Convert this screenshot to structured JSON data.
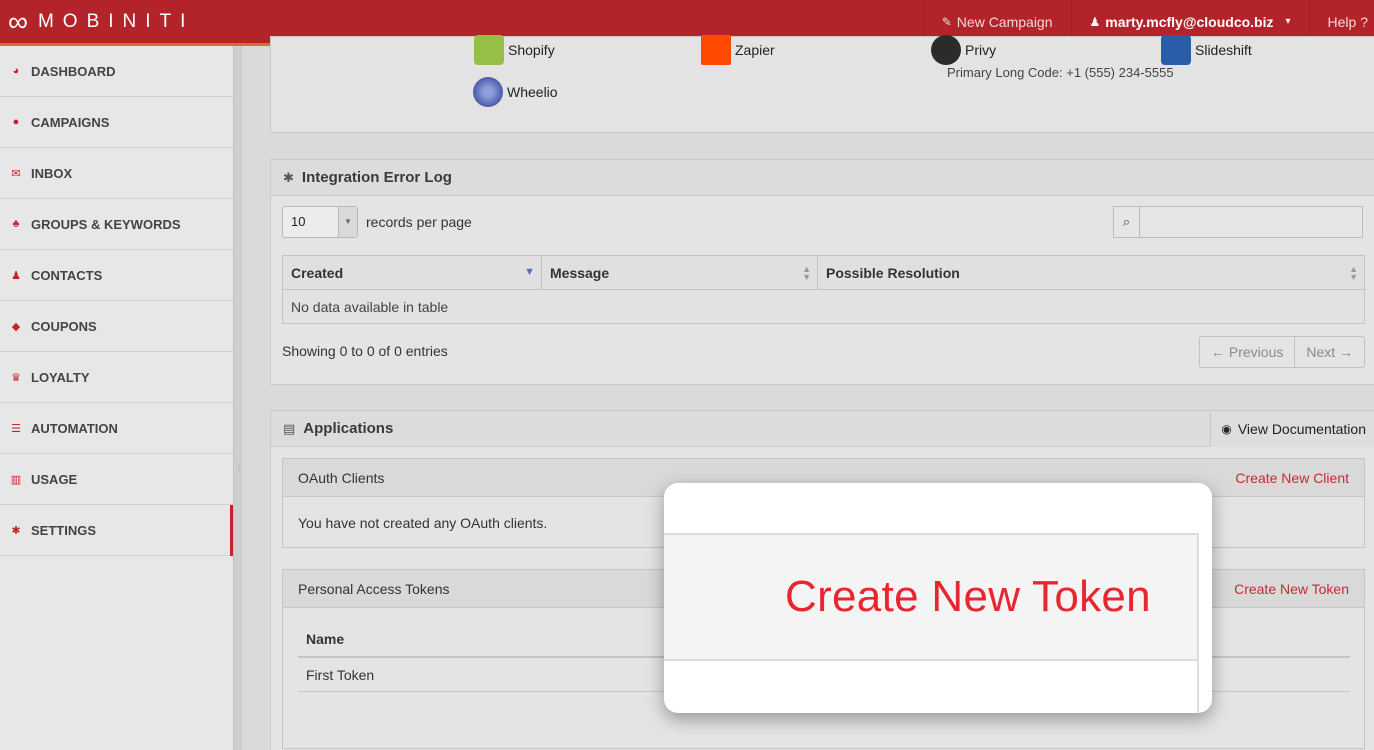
{
  "header": {
    "logo_symbol": "∞",
    "logo_text": "MOBINITI",
    "new_campaign_label": "New Campaign",
    "user_email": "marty.mcfly@cloudco.biz",
    "help_label": "Help ?"
  },
  "sidebar": {
    "items": [
      {
        "label": "DASHBOARD",
        "icon": "dashboard-icon"
      },
      {
        "label": "CAMPAIGNS",
        "icon": "comment-icon"
      },
      {
        "label": "INBOX",
        "icon": "envelope-icon"
      },
      {
        "label": "GROUPS & KEYWORDS",
        "icon": "users-icon"
      },
      {
        "label": "CONTACTS",
        "icon": "user-icon"
      },
      {
        "label": "COUPONS",
        "icon": "tag-icon"
      },
      {
        "label": "LOYALTY",
        "icon": "trophy-icon"
      },
      {
        "label": "AUTOMATION",
        "icon": "list-icon"
      },
      {
        "label": "USAGE",
        "icon": "bar-chart-icon"
      },
      {
        "label": "SETTINGS",
        "icon": "gear-icon"
      }
    ],
    "active": "SETTINGS"
  },
  "integrations": {
    "wheelio_label": "Wheelio",
    "shopify_label": "Shopify",
    "zapier_label": "Zapier",
    "privy_label": "Privy",
    "slideshift_label": "Slideshift",
    "primary_long_code": "Primary Long Code: +1 (555) 234-5555"
  },
  "error_log": {
    "title": "Integration Error Log",
    "page_size": "10",
    "records_per_page_label": "records per page",
    "search_placeholder": "",
    "columns": [
      "Created",
      "Message",
      "Possible Resolution"
    ],
    "empty_message": "No data available in table",
    "info": "Showing 0 to 0 of 0 entries",
    "prev_label": "← Previous",
    "next_label": "Next →"
  },
  "applications": {
    "title": "Applications",
    "view_docs_label": "View Documentation",
    "oauth": {
      "title": "OAuth Clients",
      "create_label": "Create New Client",
      "empty_text": "You have not created any OAuth clients."
    },
    "tokens": {
      "title": "Personal Access Tokens",
      "create_label": "Create New Token",
      "column_name": "Name",
      "rows": [
        "First Token"
      ]
    }
  },
  "callout": {
    "text": "Create New Token",
    "color": "#e8262d"
  },
  "colors": {
    "brand": "#b3232a",
    "accent_underline": "#d4702b",
    "link_red": "#c22c32"
  }
}
